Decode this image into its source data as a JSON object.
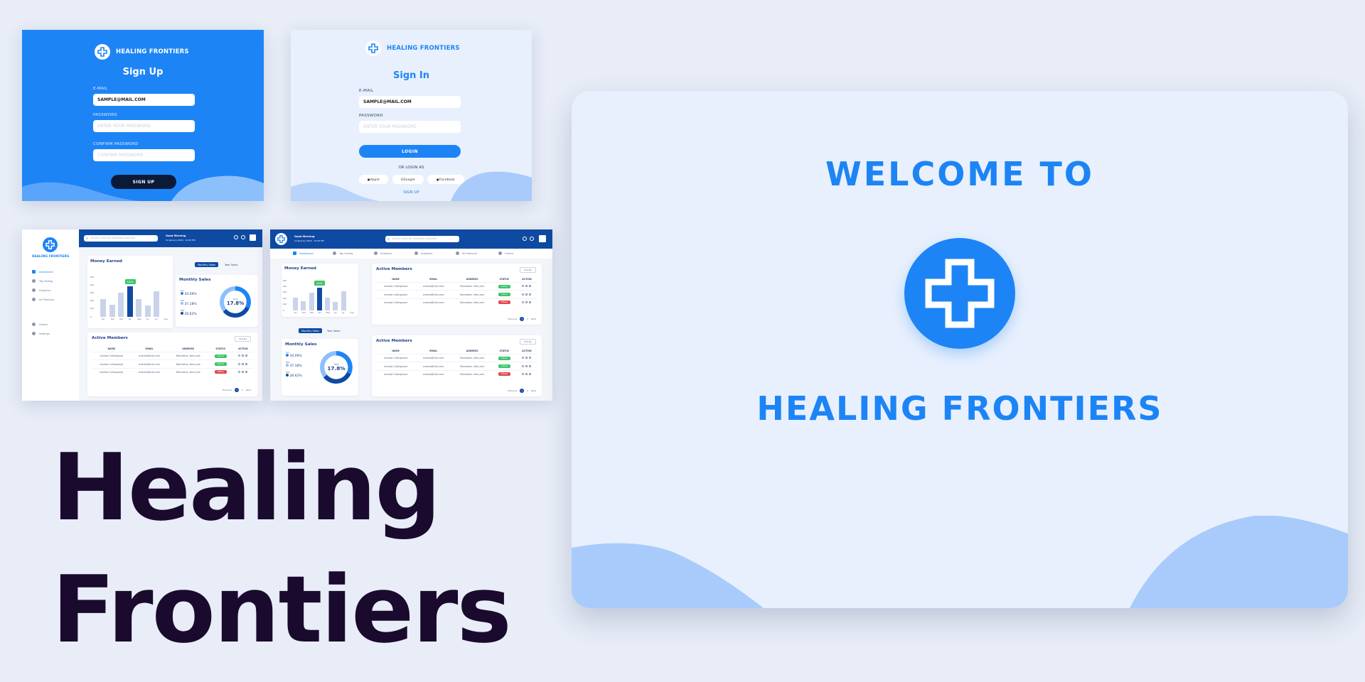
{
  "brand": {
    "name": "HEALING FRONTIERS",
    "accent": "#1d84f5",
    "dark": "#0f4aa2"
  },
  "signup": {
    "title": "Sign Up",
    "email_label": "E-MAIL",
    "email_value": "SAMPLE@MAIL.COM",
    "password_label": "PASSWORD",
    "password_placeholder": "ENTER YOUR PASSWORD",
    "confirm_label": "CONFIRM PASSWORD",
    "confirm_placeholder": "CONFIRM PASSWORD",
    "button": "SIGN UP"
  },
  "signin": {
    "title": "Sign In",
    "email_label": "E-MAIL",
    "email_value": "SAMPLE@MAIL.COM",
    "password_label": "PASSWORD",
    "password_placeholder": "ENTER YOUR PASSWORD",
    "button": "LOGIN",
    "or_text": "OR LOGIN AS",
    "social": [
      "Apple",
      "Google",
      "Facebook"
    ],
    "signup_link": "SIGN UP"
  },
  "dashboard": {
    "greeting": "Good Morning",
    "date": "12 January 2024 · 10:45 PM",
    "search_placeholder": "Search here for medicine products",
    "sidebar": [
      "Dashboard",
      "Top Selling",
      "Analytics",
      "All Products",
      "Orders",
      "Settings"
    ],
    "tabs": [
      "Dashboard",
      "Top Selling",
      "Analytics",
      "Analytics",
      "All Products",
      "Orders"
    ],
    "money_title": "Money Earned",
    "money_badge": "$429",
    "toggle_monthly": "Monthly Sales",
    "toggle_year": "Year Sales",
    "sales_title": "Monthly Sales",
    "donut_label": "Total",
    "donut_value": "17.8%",
    "legend": [
      {
        "label": "Jan",
        "value": "34.09%"
      },
      {
        "label": "Feb",
        "value": "37.18%"
      },
      {
        "label": "Mar",
        "value": "28.62%"
      }
    ],
    "members_title": "Active Members",
    "members_filter": "Sort By",
    "columns": [
      "NAME",
      "EMAIL",
      "ADDRESS",
      "STATUS",
      "ACTION"
    ],
    "rows": [
      {
        "name": "Andrew Collingwood",
        "email": "andrew@mail.com",
        "address": "Manhattan, New york",
        "status": "Active"
      },
      {
        "name": "Andrew Collingwood",
        "email": "andrew@mail.com",
        "address": "Manhattan, New york",
        "status": "Active"
      },
      {
        "name": "Andrew Collingwood",
        "email": "andrew@mail.com",
        "address": "Manhattan, New york",
        "status": "Offline"
      }
    ],
    "pagination": [
      "Previous",
      "1",
      "2",
      "Next"
    ]
  },
  "chart_data": {
    "type": "bar",
    "categories": [
      "Jan",
      "Feb",
      "Mar",
      "Apr",
      "May",
      "Jun",
      "Jul",
      "Aug"
    ],
    "values": [
      22,
      15,
      30,
      38,
      22,
      14,
      32,
      0
    ],
    "ylim": [
      0,
      50
    ],
    "yticks": [
      "0",
      "$10",
      "$20",
      "$30",
      "$40",
      "$50"
    ],
    "highlight_index": 3
  },
  "hero": {
    "line1": "Healing",
    "line2": "Frontiers"
  },
  "welcome": {
    "title": "WELCOME TO",
    "brand": "HEALING FRONTIERS"
  }
}
